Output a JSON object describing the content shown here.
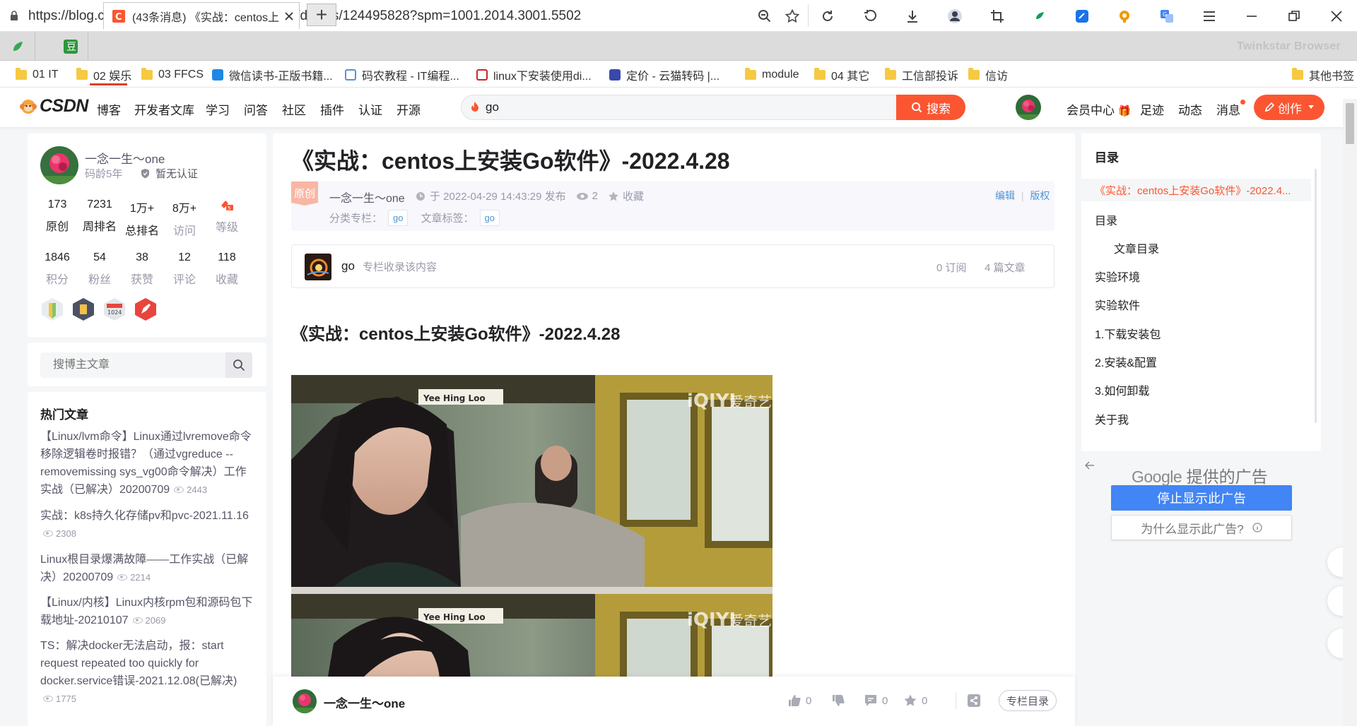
{
  "browser": {
    "url": "https://blog.csdn.net/weixin_39246554/article/details/124495828?spm=1001.2014.3001.5502",
    "brand": "Twinkstar Browser",
    "active_tab": {
      "title": "(43条消息) 《实战：centos上"
    },
    "new_tab_label": "+"
  },
  "bookmarks": [
    {
      "label": "01 IT",
      "icon": "folder-icon"
    },
    {
      "label": "02 娱乐",
      "icon": "folder-icon"
    },
    {
      "label": "03 FFCS",
      "icon": "folder-icon"
    },
    {
      "label": "微信读书-正版书籍...",
      "icon": "weread-icon"
    },
    {
      "label": "码农教程 - IT编程...",
      "icon": "code-icon"
    },
    {
      "label": "linux下安装使用di...",
      "icon": "doc-icon"
    },
    {
      "label": "定价 - 云猫转码 |...",
      "icon": "cloud-icon"
    },
    {
      "label": "module",
      "icon": "folder-icon"
    },
    {
      "label": "04 其它",
      "icon": "folder-icon"
    },
    {
      "label": "工信部投诉",
      "icon": "folder-icon"
    },
    {
      "label": "信访",
      "icon": "folder-icon"
    },
    {
      "label": "其他书签",
      "icon": "folder-icon"
    }
  ],
  "nav": {
    "logo": "CSDN",
    "links": [
      "博客",
      "开发者文库",
      "学习",
      "问答",
      "社区",
      "插件",
      "认证",
      "开源"
    ],
    "search_value": "go",
    "search_button": "搜索",
    "right_links": [
      "会员中心",
      "足迹",
      "动态",
      "消息"
    ],
    "create_button": "创作",
    "colors": {
      "accent": "#fc5531"
    }
  },
  "profile": {
    "name": "一念一生～one",
    "age": "码龄5年",
    "verify": "暂无认证",
    "stats_row1": [
      {
        "value": "173",
        "label": "原创"
      },
      {
        "value": "7231",
        "label": "周排名"
      },
      {
        "value": "1万+",
        "label": "总排名"
      },
      {
        "value": "8万+",
        "label": "访问"
      },
      {
        "value": "",
        "label": "等级"
      }
    ],
    "stats_row2": [
      {
        "value": "1846",
        "label": "积分"
      },
      {
        "value": "54",
        "label": "粉丝"
      },
      {
        "value": "38",
        "label": "获赞"
      },
      {
        "value": "12",
        "label": "评论"
      },
      {
        "value": "118",
        "label": "收藏"
      }
    ],
    "badge_1024": "1024"
  },
  "blog_search": {
    "placeholder": "搜博主文章"
  },
  "hot": {
    "title": "热门文章",
    "items": [
      {
        "title": "【Linux/lvm命令】Linux通过lvremove命令移除逻辑卷时报错？（通过vgreduce --removemissing sys_vg00命令解决）工作实战（已解决）20200709",
        "views": "2443"
      },
      {
        "title": "实战：k8s持久化存储pv和pvc-2021.11.16",
        "views": "2308"
      },
      {
        "title": "Linux根目录爆满故障——工作实战（已解决）20200709",
        "views": "2214"
      },
      {
        "title": "【Linux/内核】Linux内核rpm包和源码包下载地址-20210107",
        "views": "2069"
      },
      {
        "title": "TS：解决docker无法启动，报：start request repeated too quickly for docker.service错误-2021.12.08(已解决)",
        "views": "1775"
      }
    ]
  },
  "article": {
    "title": "《实战：centos上安装Go软件》-2022.4.28",
    "original_tag": "原创",
    "author": "一念一生～one",
    "time": "于 2022-04-29 14:43:29 发布",
    "views": "2",
    "favorite": "收藏",
    "edit": "编辑",
    "copyright": "版权",
    "category_label": "分类专栏：",
    "category": "go",
    "tag_label": "文章标签：",
    "tag": "go",
    "column": {
      "name": "go",
      "desc": "专栏收录该内容",
      "subs": "0 订阅",
      "count": "4 篇文章"
    },
    "content_heading": "《实战：centos上安装Go软件》-2022.4.28",
    "image_sign1": "Yee Hing Loo",
    "image_watermark": "爱奇艺"
  },
  "bottom_bar": {
    "author": "一念一生～one",
    "like": "0",
    "dislike": "",
    "comment": "0",
    "favorite": "0",
    "toc_button": "专栏目录"
  },
  "toc": {
    "title": "目录",
    "items": [
      {
        "label": "《实战：centos上安装Go软件》-2022.4...",
        "level": 1,
        "active": true
      },
      {
        "label": "目录",
        "level": 1
      },
      {
        "label": "文章目录",
        "level": 2
      },
      {
        "label": "实验环境",
        "level": 1
      },
      {
        "label": "实验软件",
        "level": 1
      },
      {
        "label": "1.下载安装包",
        "level": 1
      },
      {
        "label": "2.安装&配置",
        "level": 1
      },
      {
        "label": "3.如何卸载",
        "level": 1
      },
      {
        "label": "关于我",
        "level": 1
      }
    ]
  },
  "ad": {
    "brand": "Google",
    "provided": "提供的广告",
    "stop": "停止显示此广告",
    "why": "为什么显示此广告?"
  }
}
